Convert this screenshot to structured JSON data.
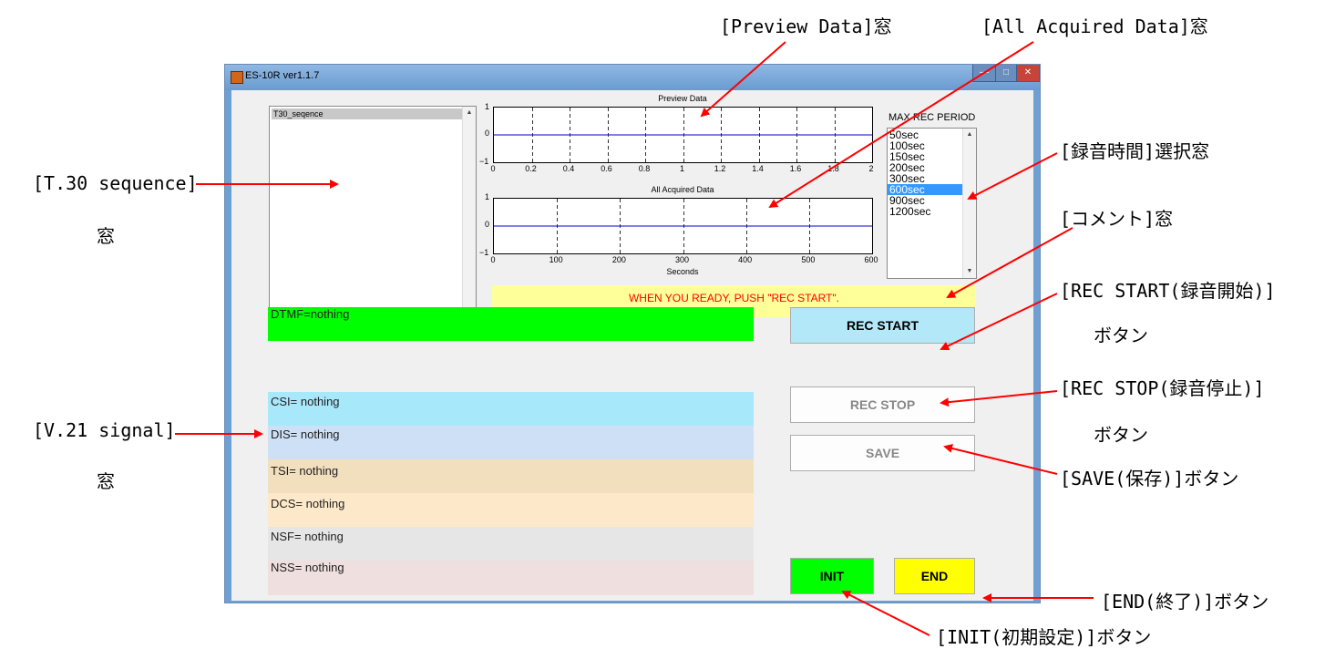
{
  "window": {
    "title": "ES-10R  ver1.1.7",
    "sequence_list": {
      "items": [
        "T30_seqence"
      ]
    },
    "preview_plot": {
      "title": "Preview Data",
      "x_ticks": [
        "0",
        "0.2",
        "0.4",
        "0.6",
        "0.8",
        "1",
        "1.2",
        "1.4",
        "1.6",
        "1.8",
        "2"
      ],
      "y_ticks": [
        "1",
        "0",
        "−1"
      ]
    },
    "acquired_plot": {
      "title": "All Acquired Data",
      "x_ticks": [
        "0",
        "100",
        "200",
        "300",
        "400",
        "500",
        "600"
      ],
      "y_ticks": [
        "1",
        "0",
        "−1"
      ],
      "xlabel": "Seconds"
    },
    "rec_period": {
      "label": "MAX REC PERIOD",
      "options": [
        "50sec",
        "100sec",
        "150sec",
        "200sec",
        "300sec",
        "600sec",
        "900sec",
        "1200sec"
      ],
      "selected": "600sec"
    },
    "comment": "WHEN YOU READY, PUSH \"REC START\".",
    "dtmf": "DTMF=nothing",
    "signals": {
      "csi": "CSI=   nothing",
      "dis": "DIS=   nothing",
      "tsi": "TSI=   nothing",
      "dcs": "DCS=  nothing",
      "nsf": "NSF=  nothing",
      "nss": "NSS=  nothing"
    },
    "buttons": {
      "rec_start": "REC START",
      "rec_stop": "REC STOP",
      "save": "SAVE",
      "init": "INIT",
      "end": "END"
    },
    "colors": {
      "dtmf": "#00ff00",
      "csi": "#a8e8fb",
      "dis": "#cde0f5",
      "tsi": "#f2dfbe",
      "dcs": "#fde9ca",
      "nsf": "#e6e6e6",
      "nss": "#f0dfdf",
      "comment": "#ffff99",
      "rec_start": "#b2e8f7",
      "init": "#00ff00",
      "end": "#ffff00",
      "selected_option": "#3399ff"
    }
  },
  "annotations": {
    "preview": "[Preview Data]窓",
    "acquired": "[All Acquired Data]窓",
    "rec_time": "[録音時間]選択窓",
    "comment": "[コメント]窓",
    "rec_start_1": "[REC START(録音開始)]",
    "rec_start_2": "ボタン",
    "rec_stop_1": "[REC STOP(録音停止)]",
    "rec_stop_2": "ボタン",
    "save": "[SAVE(保存)]ボタン",
    "end": "[END(終了)]ボタン",
    "init": "[INIT(初期設定)]ボタン",
    "t30_1": "[T.30 sequence]",
    "t30_2": "窓",
    "v21_1": "[V.21 signal]",
    "v21_2": "窓"
  }
}
